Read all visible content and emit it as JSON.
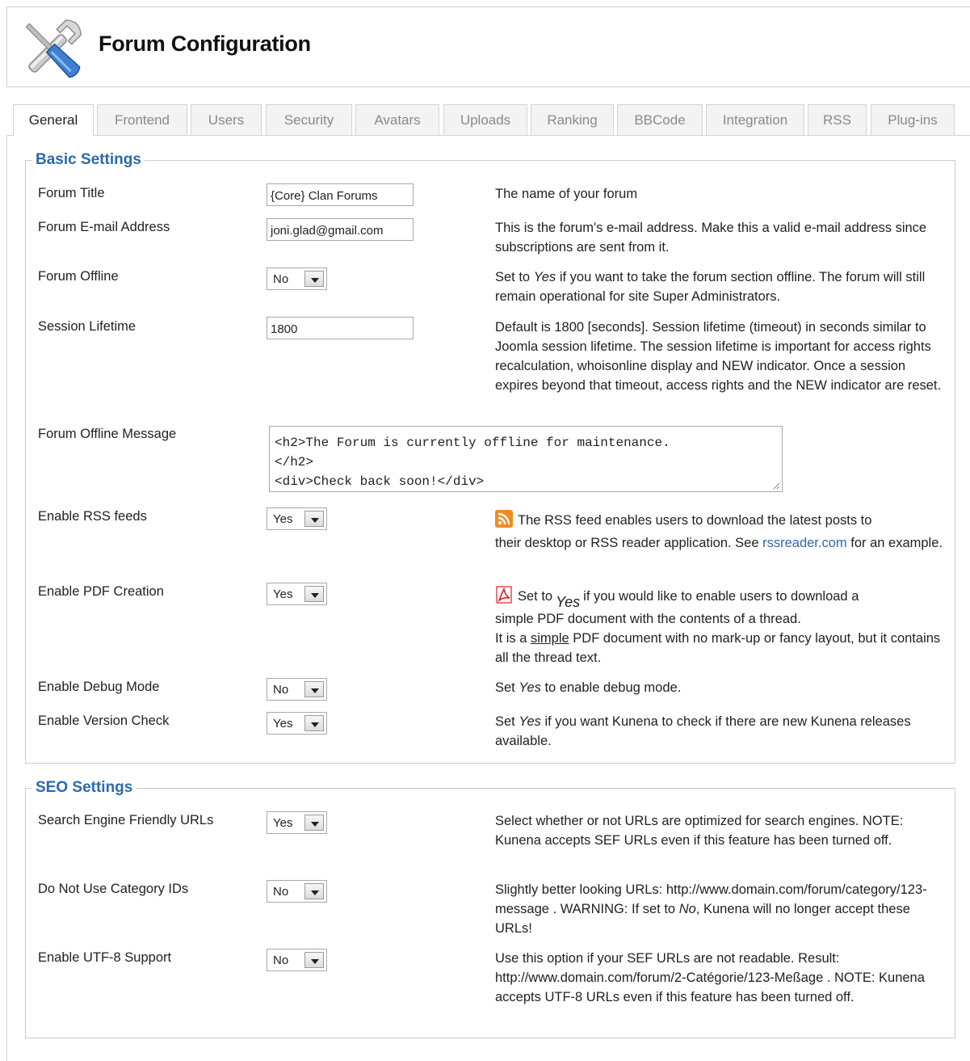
{
  "header": {
    "title": "Forum Configuration",
    "logo_icon": "wrench-screwdriver-icon"
  },
  "tabs": [
    {
      "label": "General",
      "active": true
    },
    {
      "label": "Frontend"
    },
    {
      "label": "Users"
    },
    {
      "label": "Security"
    },
    {
      "label": "Avatars"
    },
    {
      "label": "Uploads"
    },
    {
      "label": "Ranking"
    },
    {
      "label": "BBCode"
    },
    {
      "label": "Integration"
    },
    {
      "label": "RSS"
    },
    {
      "label": "Plug-ins"
    }
  ],
  "basic": {
    "legend": "Basic Settings",
    "forum_title": {
      "label": "Forum Title",
      "value": "{Core} Clan Forums",
      "desc": "The name of your forum"
    },
    "forum_email": {
      "label": "Forum E-mail Address",
      "value": "joni.glad@gmail.com",
      "desc": "This is the forum's e-mail address. Make this a valid e-mail address since subscriptions are sent from it."
    },
    "forum_offline": {
      "label": "Forum Offline",
      "value": "No",
      "desc_pre": "Set to ",
      "desc_em": "Yes",
      "desc_post": " if you want to take the forum section offline. The forum will still remain operational for site Super Administrators."
    },
    "session_lifetime": {
      "label": "Session Lifetime",
      "value": "1800",
      "desc": "Default is 1800 [seconds]. Session lifetime (timeout) in seconds similar to Joomla session lifetime. The session lifetime is important for access rights recalculation, whoisonline display and NEW indicator. Once a session expires beyond that timeout, access rights and the NEW indicator are reset."
    },
    "offline_message": {
      "label": "Forum Offline Message",
      "value": "<h2>The Forum is currently offline for maintenance.\n</h2>\n<div>Check back soon!</div>"
    },
    "rss": {
      "label": "Enable RSS feeds",
      "value": "Yes",
      "icon": "rss-icon",
      "desc_first": "The RSS feed enables users to download the latest posts to",
      "desc_second": "their desktop or RSS reader application. See ",
      "link": "rssreader.com",
      "desc_after": " for an example."
    },
    "pdf": {
      "label": "Enable PDF Creation",
      "value": "Yes",
      "icon": "pdf-icon",
      "desc_a": "Set to",
      "desc_em": "Yes",
      "desc_b": "if you would like to enable users to download a",
      "desc_c": "simple PDF document with the contents of a thread.",
      "desc_d_pre": "It is a ",
      "desc_d_u": "simple",
      "desc_d_post": " PDF document with no mark-up or fancy layout, but it contains all the thread text."
    },
    "debug": {
      "label": "Enable Debug Mode",
      "value": "No",
      "desc_pre": "Set ",
      "desc_em": "Yes",
      "desc_post": " to enable debug mode."
    },
    "version_check": {
      "label": "Enable Version Check",
      "value": "Yes",
      "desc_pre": "Set ",
      "desc_em": "Yes",
      "desc_post": " if you want Kunena to check if there are new Kunena releases available."
    }
  },
  "seo": {
    "legend": "SEO Settings",
    "sef_urls": {
      "label": "Search Engine Friendly URLs",
      "value": "Yes",
      "desc": "Select whether or not URLs are optimized for search engines. NOTE: Kunena accepts SEF URLs even if this feature has been turned off."
    },
    "no_cat_ids": {
      "label": "Do Not Use Category IDs",
      "value": "No",
      "desc_pre": "Slightly better looking URLs: http://www.domain.com/forum/category/123-message . WARNING: If set to ",
      "desc_em": "No",
      "desc_post": ", Kunena will no longer accept these URLs!"
    },
    "utf8": {
      "label": "Enable UTF-8 Support",
      "value": "No",
      "desc": "Use this option if your SEF URLs are not readable. Result: http://www.domain.com/forum/2-Catégorie/123-Meßage . NOTE: Kunena accepts UTF-8 URLs even if this feature has been turned off."
    }
  },
  "colors": {
    "legend": "#2a6aac",
    "link": "#2a6aac",
    "tab_inactive_text": "#8a8a8a"
  }
}
